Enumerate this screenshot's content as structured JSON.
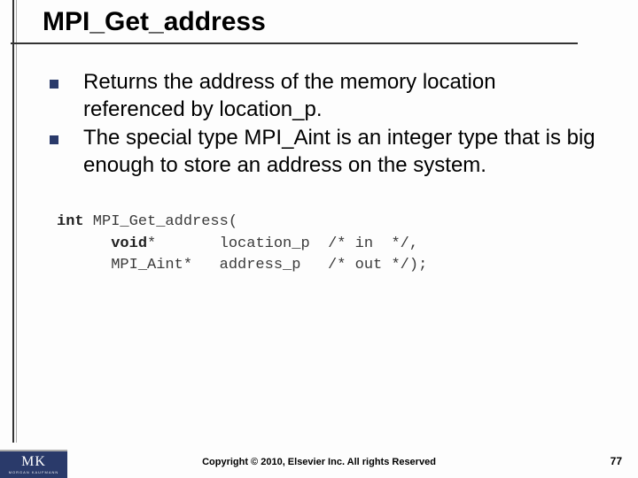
{
  "title": "MPI_Get_address",
  "bullets": [
    "Returns the address of the memory location referenced by location_p.",
    "The special type MPI_Aint is an integer type that is big enough to store an address on the system."
  ],
  "code": {
    "line1_ret": "int",
    "line1_fn": " MPI_Get_address(",
    "line2_type": "void",
    "line2_rest": "*       location_p  /* in  */,",
    "line3": "      MPI_Aint*   address_p   /* out */);"
  },
  "footer": {
    "copyright": "Copyright © 2010, Elsevier Inc. All rights Reserved",
    "page": "77",
    "publisher_initials": "MK",
    "publisher_name": "MORGAN KAUFMANN"
  }
}
